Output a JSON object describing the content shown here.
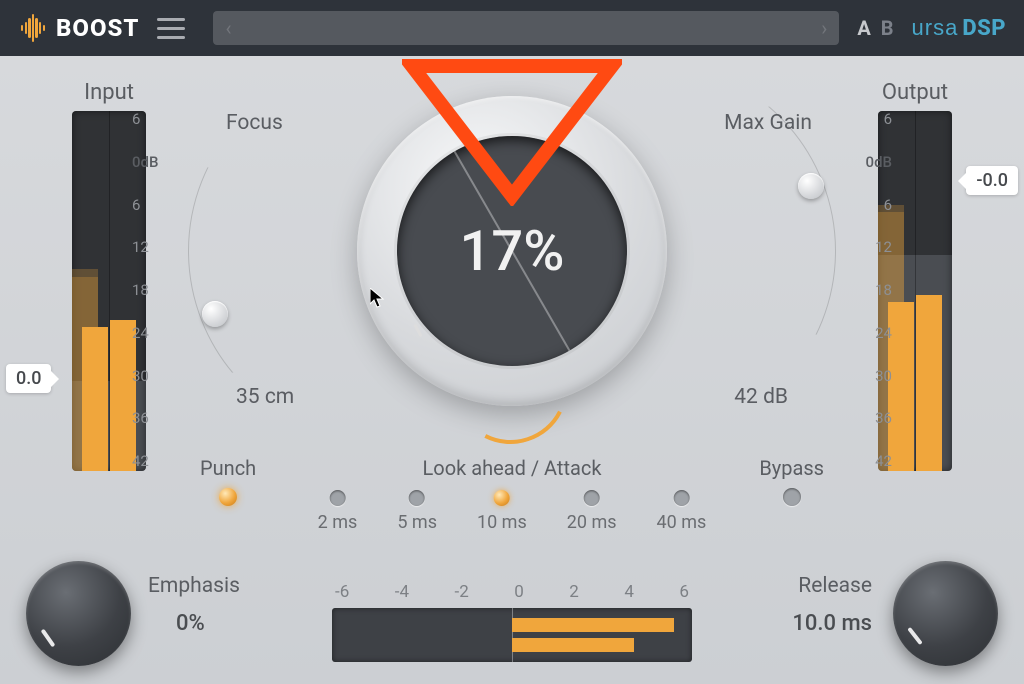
{
  "header": {
    "product": "BOOST",
    "brand_left": "ursa",
    "brand_right": "DSP",
    "ab_a": "A",
    "ab_b": "B"
  },
  "meters": {
    "input_label": "Input",
    "output_label": "Output",
    "scale": [
      "6",
      "0dB",
      "6",
      "12",
      "18",
      "24",
      "30",
      "36",
      "42"
    ],
    "input_readout": "0.0",
    "output_readout": "-0.0",
    "input_level_l_pct": 40,
    "input_level_r_pct": 42,
    "output_level_l_pct": 47,
    "output_level_r_pct": 49
  },
  "knob": {
    "value_pct": "17%"
  },
  "focus": {
    "label": "Focus",
    "value": "35 cm"
  },
  "maxgain": {
    "label": "Max Gain",
    "value": "42 dB"
  },
  "lookahead": {
    "label": "Look ahead / Attack",
    "options": [
      "2 ms",
      "5 ms",
      "10 ms",
      "20 ms",
      "40 ms"
    ],
    "active_index": 2
  },
  "punch": {
    "label": "Punch",
    "on": true
  },
  "bypass": {
    "label": "Bypass",
    "on": false
  },
  "emphasis": {
    "label": "Emphasis",
    "value": "0%"
  },
  "release": {
    "label": "Release",
    "value": "10.0 ms"
  },
  "gr": {
    "scale": [
      "-6",
      "-4",
      "-2",
      "0",
      "2",
      "4",
      "6"
    ]
  },
  "colors": {
    "accent": "#f0a63c",
    "annotation": "#ff4a12"
  }
}
